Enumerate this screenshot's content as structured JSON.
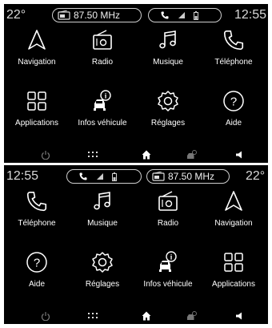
{
  "top": {
    "status": {
      "temperature": "22°",
      "frequency": "87.50 MHz",
      "clock": "12:55"
    },
    "tiles": [
      {
        "label": "Navigation",
        "icon": "navigation-icon"
      },
      {
        "label": "Radio",
        "icon": "radio-icon"
      },
      {
        "label": "Musique",
        "icon": "music-icon"
      },
      {
        "label": "Téléphone",
        "icon": "phone-icon"
      },
      {
        "label": "Applications",
        "icon": "apps-grid-icon"
      },
      {
        "label": "Infos véhicule",
        "icon": "vehicle-info-icon"
      },
      {
        "label": "Réglages",
        "icon": "settings-gear-icon"
      },
      {
        "label": "Aide",
        "icon": "help-icon"
      }
    ],
    "dock": [
      "power-icon",
      "apps-dots-icon",
      "home-icon",
      "vehicle-icon",
      "volume-icon"
    ]
  },
  "bottom": {
    "status": {
      "temperature": "22°",
      "frequency": "87.50 MHz",
      "clock": "12:55"
    },
    "tiles": [
      {
        "label": "Téléphone",
        "icon": "phone-icon"
      },
      {
        "label": "Musique",
        "icon": "music-icon"
      },
      {
        "label": "Radio",
        "icon": "radio-icon"
      },
      {
        "label": "Navigation",
        "icon": "navigation-icon"
      },
      {
        "label": "Aide",
        "icon": "help-icon"
      },
      {
        "label": "Réglages",
        "icon": "settings-gear-icon"
      },
      {
        "label": "Infos véhicule",
        "icon": "vehicle-info-icon"
      },
      {
        "label": "Applications",
        "icon": "apps-grid-icon"
      }
    ],
    "dock": [
      "power-icon",
      "apps-dots-icon",
      "home-icon",
      "vehicle-icon",
      "volume-icon"
    ]
  }
}
